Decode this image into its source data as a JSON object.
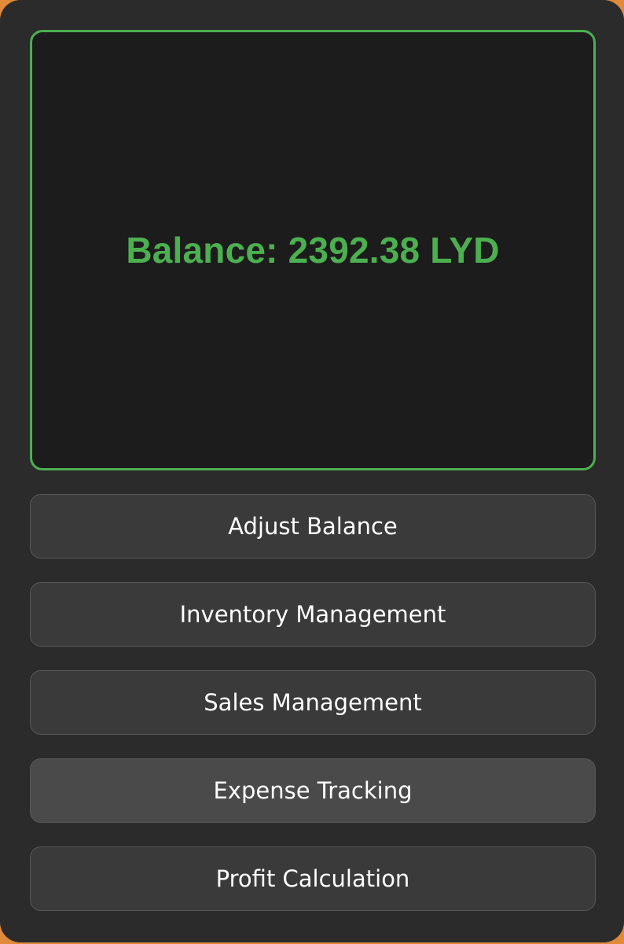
{
  "balance": {
    "text": "Balance: 2392.38 LYD"
  },
  "buttons": [
    {
      "label": "Adjust Balance"
    },
    {
      "label": "Inventory Management"
    },
    {
      "label": "Sales Management"
    },
    {
      "label": "Expense Tracking"
    },
    {
      "label": "Profit Calculation"
    }
  ],
  "colors": {
    "window_bg": "#2b2b2b",
    "panel_bg": "#1c1c1c",
    "accent": "#4caf50",
    "button_bg": "#3a3a3a",
    "button_hover_bg": "#4a4a4a",
    "desktop_bg": "#e08a3a"
  }
}
